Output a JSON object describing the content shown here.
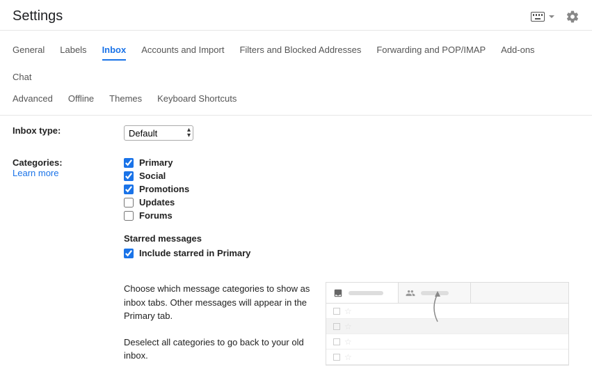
{
  "header": {
    "title": "Settings"
  },
  "tabs": {
    "row1": [
      "General",
      "Labels",
      "Inbox",
      "Accounts and Import",
      "Filters and Blocked Addresses",
      "Forwarding and POP/IMAP",
      "Add-ons",
      "Chat"
    ],
    "row2": [
      "Advanced",
      "Offline",
      "Themes",
      "Keyboard Shortcuts"
    ],
    "active": "Inbox"
  },
  "inboxType": {
    "label": "Inbox type:",
    "value": "Default",
    "options": [
      "Default"
    ]
  },
  "categories": {
    "label": "Categories:",
    "learnMore": "Learn more",
    "items": [
      {
        "label": "Primary",
        "checked": true
      },
      {
        "label": "Social",
        "checked": true
      },
      {
        "label": "Promotions",
        "checked": true
      },
      {
        "label": "Updates",
        "checked": false
      },
      {
        "label": "Forums",
        "checked": false
      }
    ],
    "starred": {
      "heading": "Starred messages",
      "label": "Include starred in Primary",
      "checked": true
    },
    "help": {
      "p1": "Choose which message categories to show as inbox tabs. Other messages will appear in the Primary tab.",
      "p2": "Deselect all categories to go back to your old inbox."
    }
  }
}
